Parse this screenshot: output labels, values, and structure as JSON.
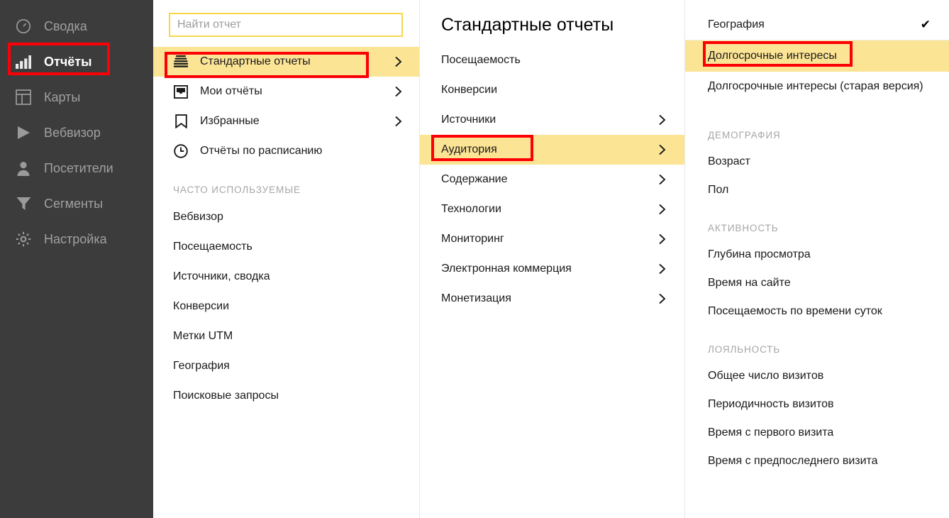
{
  "colors": {
    "sidebar_bg": "#3c3c3c",
    "highlight": "#fce495",
    "annotation_red": "#fb0007",
    "search_border": "#f7d64a",
    "muted_text": "#a6a6a6"
  },
  "sidebar": {
    "items": [
      {
        "label": "Сводка",
        "icon": "speedometer-icon",
        "active": false
      },
      {
        "label": "Отчёты",
        "icon": "bar-chart-icon",
        "active": true
      },
      {
        "label": "Карты",
        "icon": "layout-grid-icon",
        "active": false
      },
      {
        "label": "Вебвизор",
        "icon": "play-triangle-icon",
        "active": false
      },
      {
        "label": "Посетители",
        "icon": "person-icon",
        "active": false
      },
      {
        "label": "Сегменты",
        "icon": "funnel-icon",
        "active": false
      },
      {
        "label": "Настройка",
        "icon": "gear-icon",
        "active": false
      }
    ]
  },
  "panel2": {
    "search": {
      "placeholder": "Найти отчет",
      "value": ""
    },
    "menu": [
      {
        "label": "Стандартные отчеты",
        "icon": "stacked-lines-icon",
        "chevron": true,
        "highlighted": true
      },
      {
        "label": "Мои отчёты",
        "icon": "inbox-tray-icon",
        "chevron": true,
        "highlighted": false
      },
      {
        "label": "Избранные",
        "icon": "bookmark-icon",
        "chevron": true,
        "highlighted": false
      },
      {
        "label": "Отчёты по расписанию",
        "icon": "clock-icon",
        "chevron": false,
        "highlighted": false
      }
    ],
    "section_label": "ЧАСТО ИСПОЛЬЗУЕМЫЕ",
    "frequent": [
      {
        "label": "Вебвизор"
      },
      {
        "label": "Посещаемость"
      },
      {
        "label": "Источники, сводка"
      },
      {
        "label": "Конверсии"
      },
      {
        "label": "Метки UTM"
      },
      {
        "label": "География"
      },
      {
        "label": "Поисковые запросы"
      }
    ]
  },
  "panel3": {
    "title": "Стандартные отчеты",
    "items": [
      {
        "label": "Посещаемость",
        "chevron": false,
        "highlighted": false
      },
      {
        "label": "Конверсии",
        "chevron": false,
        "highlighted": false
      },
      {
        "label": "Источники",
        "chevron": true,
        "highlighted": false
      },
      {
        "label": "Аудитория",
        "chevron": true,
        "highlighted": true
      },
      {
        "label": "Содержание",
        "chevron": true,
        "highlighted": false
      },
      {
        "label": "Технологии",
        "chevron": true,
        "highlighted": false
      },
      {
        "label": "Мониторинг",
        "chevron": true,
        "highlighted": false
      },
      {
        "label": "Электронная коммерция",
        "chevron": true,
        "highlighted": false
      },
      {
        "label": "Монетизация",
        "chevron": true,
        "highlighted": false
      }
    ]
  },
  "panel4": {
    "items": [
      {
        "type": "item",
        "label": "География",
        "checked": true,
        "highlighted": false,
        "two_line": false
      },
      {
        "type": "separator"
      },
      {
        "type": "item",
        "label": "Долгосрочные интересы",
        "checked": false,
        "highlighted": true,
        "two_line": false
      },
      {
        "type": "item",
        "label": "Долгосрочные интересы (старая версия)",
        "checked": false,
        "highlighted": false,
        "two_line": true
      },
      {
        "type": "section",
        "label": "ДЕМОГРАФИЯ"
      },
      {
        "type": "item",
        "label": "Возраст",
        "checked": false,
        "highlighted": false,
        "two_line": false
      },
      {
        "type": "item",
        "label": "Пол",
        "checked": false,
        "highlighted": false,
        "two_line": false
      },
      {
        "type": "section",
        "label": "АКТИВНОСТЬ"
      },
      {
        "type": "item",
        "label": "Глубина просмотра",
        "checked": false,
        "highlighted": false,
        "two_line": false
      },
      {
        "type": "item",
        "label": "Время на сайте",
        "checked": false,
        "highlighted": false,
        "two_line": false
      },
      {
        "type": "item",
        "label": "Посещаемость по времени суток",
        "checked": false,
        "highlighted": false,
        "two_line": false
      },
      {
        "type": "section",
        "label": "ЛОЯЛЬНОСТЬ"
      },
      {
        "type": "item",
        "label": "Общее число визитов",
        "checked": false,
        "highlighted": false,
        "two_line": false
      },
      {
        "type": "item",
        "label": "Периодичность визитов",
        "checked": false,
        "highlighted": false,
        "two_line": false
      },
      {
        "type": "item",
        "label": "Время с первого визита",
        "checked": false,
        "highlighted": false,
        "two_line": false
      },
      {
        "type": "item",
        "label": "Время с предпоследнего визита",
        "checked": false,
        "highlighted": false,
        "two_line": false
      }
    ],
    "check_glyph": "✔"
  },
  "annotations": [
    {
      "name": "annotation-box-reports",
      "target": "Отчёты"
    },
    {
      "name": "annotation-box-standard-reports",
      "target": "Стандартные отчеты"
    },
    {
      "name": "annotation-box-audience",
      "target": "Аудитория"
    },
    {
      "name": "annotation-box-longterm-interests",
      "target": "Долгосрочные интересы"
    }
  ]
}
